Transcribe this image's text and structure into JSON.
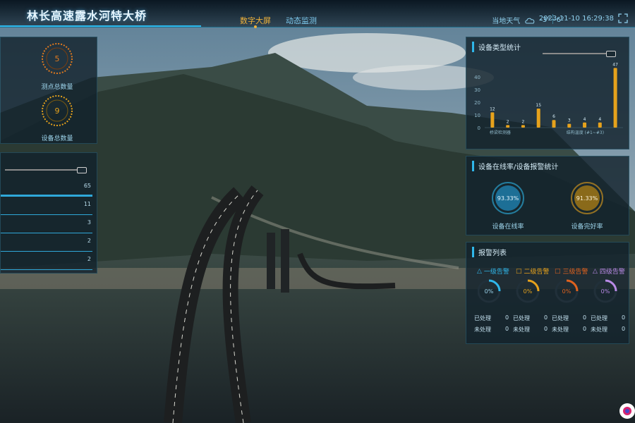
{
  "header": {
    "title": "林长高速露水河特大桥",
    "tabs": [
      {
        "label": "数字大屏",
        "active": true
      },
      {
        "label": "动态监测",
        "active": false
      }
    ],
    "weather": {
      "label": "当地天气",
      "temp": "-3°~6°",
      "icon": "cloud-icon"
    },
    "datetime": "2023-11-10 16:29:38",
    "fullscreen_icon": "fullscreen-icon"
  },
  "left_top_panel": {
    "gauges": [
      {
        "value": "5",
        "label": "测点总数量",
        "color": "#e07a1e"
      },
      {
        "value": "9",
        "label": "设备总数量",
        "color": "#e6a21c"
      }
    ]
  },
  "left_list_panel": {
    "rows": [
      "65",
      "11",
      "3",
      "2",
      "2"
    ]
  },
  "device_chart": {
    "title": "设备类型统计",
    "chart_data": {
      "type": "bar",
      "categories": [
        "",
        "",
        "",
        "",
        "",
        "",
        "",
        "",
        ""
      ],
      "values": [
        12,
        2,
        2,
        15,
        6,
        3,
        4,
        4,
        47
      ],
      "x_tick_labels": [
        "桥梁检测器",
        "",
        "",
        "",
        "",
        "结构温度 (#1~#3)",
        "",
        "",
        ""
      ],
      "ylim": [
        0,
        50
      ],
      "yticks": [
        0,
        10,
        20,
        30,
        40
      ],
      "bar_color": "#e6a21c",
      "grid": false
    }
  },
  "online_panel": {
    "title": "设备在线率/设备报警统计",
    "stats": [
      {
        "value": "93.33%",
        "label": "设备在线率",
        "color": "#2fb7ea"
      },
      {
        "value": "91.33%",
        "label": "设备完好率",
        "color": "#e6a21c"
      }
    ]
  },
  "events_panel": {
    "title": "报警列表",
    "levels": [
      {
        "label": "一级告警",
        "color": "#2fb7ea",
        "pct": "0%"
      },
      {
        "label": "二级告警",
        "color": "#e6a21c",
        "pct": "0%"
      },
      {
        "label": "三级告警",
        "color": "#e0621e",
        "pct": "0%"
      },
      {
        "label": "四级告警",
        "color": "#b98ae6",
        "pct": "0%"
      }
    ],
    "rows": [
      [
        {
          "k": "已处理",
          "v": "0"
        },
        {
          "k": "已处理",
          "v": "0"
        },
        {
          "k": "已处理",
          "v": "0"
        },
        {
          "k": "已处理",
          "v": "0"
        }
      ],
      [
        {
          "k": "未处理",
          "v": "0"
        },
        {
          "k": "未处理",
          "v": "0"
        },
        {
          "k": "未处理",
          "v": "0"
        },
        {
          "k": "未处理",
          "v": "0"
        }
      ]
    ]
  },
  "colors": {
    "accent": "#2fb7ea",
    "orange": "#e6a21c"
  }
}
